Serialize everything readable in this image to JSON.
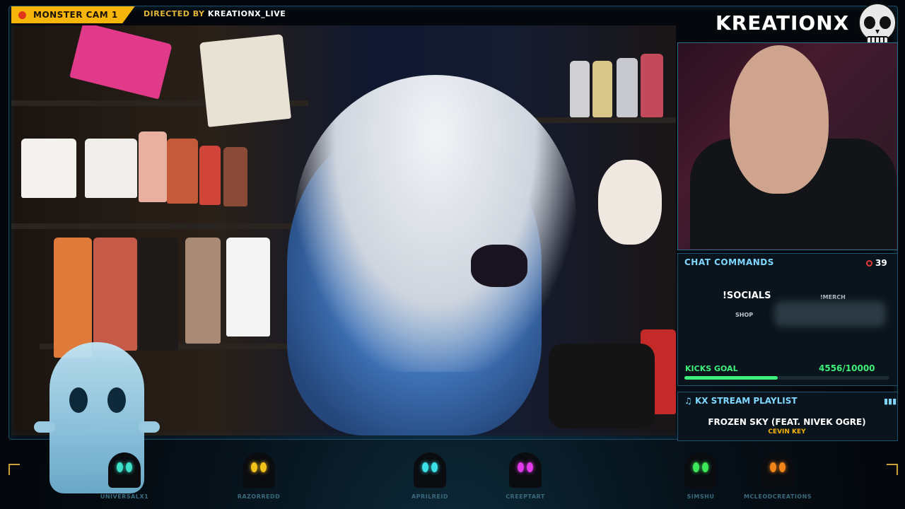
{
  "overlay": {
    "cam_label": "MONSTER CAM 1",
    "directed_prefix": "DIRECTED BY",
    "directed_name": "KREATIONX_LIVE",
    "brand": "KREATIONX"
  },
  "chat_commands": {
    "title": "CHAT COMMANDS",
    "viewer_count": "39",
    "command_main": "!SOCIALS",
    "command_merch": "!MERCH",
    "command_shop": "SHOP"
  },
  "kicks_goal": {
    "label": "KICKS GOAL",
    "value": "4556/10000",
    "progress": 0.4556
  },
  "playlist": {
    "title": "KX STREAM PLAYLIST",
    "song": "FROZEN SKY (FEAT. NIVEK OGRE)",
    "artist": "CEVIN KEY"
  },
  "viewers": [
    {
      "name": "UNIVERSALX1",
      "eye_color": "#3de0c8"
    },
    {
      "name": "RAZORREDD",
      "eye_color": "#f2c21a"
    },
    {
      "name": "APRILREID",
      "eye_color": "#3de0e8"
    },
    {
      "name": "CREEPTART",
      "eye_color": "#e23ae8"
    },
    {
      "name": "SIMSHU",
      "eye_color": "#3de85a"
    },
    {
      "name": "MCLEODCREATIONS",
      "eye_color": "#f2851a"
    }
  ],
  "colors": {
    "accent": "#f5b50a",
    "panel_title": "#7fd7ff",
    "goal": "#3ef07a"
  }
}
